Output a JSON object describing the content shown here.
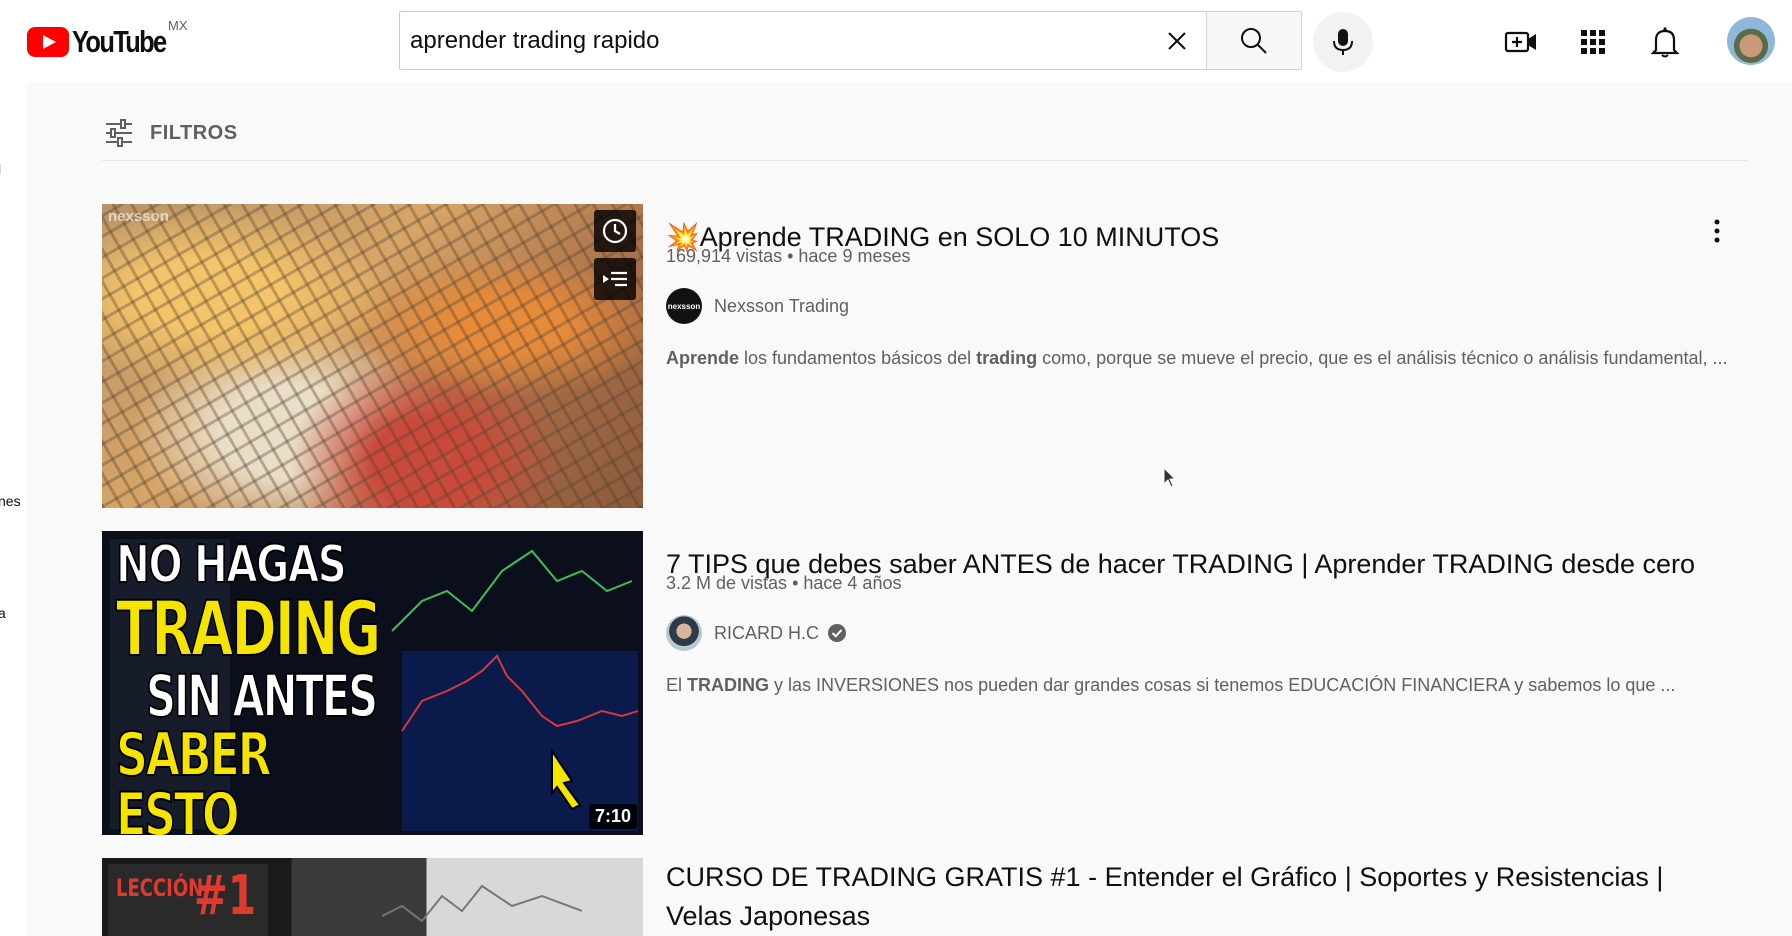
{
  "header": {
    "logo_text": "YouTube",
    "country": "MX",
    "search_value": "aprender trading rapido"
  },
  "gutter": [
    "l",
    "nes",
    "a"
  ],
  "filters": {
    "label": "FILTROS"
  },
  "results": [
    {
      "title": "💥Aprende TRADING en SOLO 10 MINUTOS",
      "views": "169,914 vistas",
      "age": "hace 9 meses",
      "channel": "Nexsson Trading",
      "channel_avatar_text": "nexsson",
      "thumb_watermark": "nexsson",
      "desc_bold1": "Aprende",
      "desc_mid1": " los fundamentos básicos del ",
      "desc_bold2": "trading",
      "desc_rest": " como, porque se mueve el precio, que es el análisis técnico o análisis fundamental, ..."
    },
    {
      "title": "7 TIPS que debes saber ANTES de hacer TRADING | Aprender TRADING desde cero",
      "views": "3.2 M de vistas",
      "age": "hace 4 años",
      "channel": "RICARD H.C",
      "verified": true,
      "desc_pre": "El ",
      "desc_bold": "TRADING",
      "desc_rest": " y las INVERSIONES nos pueden dar grandes cosas si tenemos EDUCACIÓN FINANCIERA y sabemos lo que ...",
      "duration": "7:10",
      "thumb_lines": [
        "NO HAGAS",
        "TRADING",
        "SIN ANTES",
        "SABER ESTO"
      ]
    },
    {
      "title_line1": "CURSO DE TRADING GRATIS #1 - Entender el Gráfico | Soportes y Resistencias |",
      "title_line2": "Velas Japonesas",
      "thumb_label": "LECCIÓN",
      "thumb_number": "#1"
    }
  ]
}
